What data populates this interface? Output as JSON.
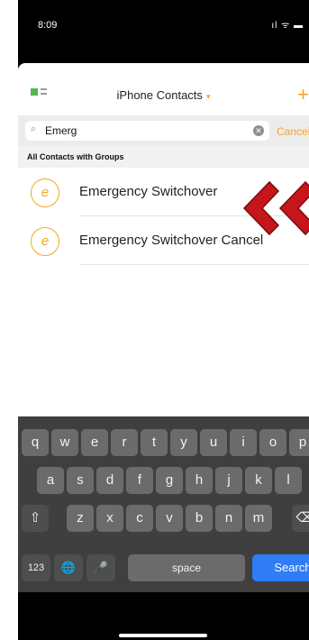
{
  "status_bar": {
    "time": "8:09",
    "icons": "ıl ᯤ ▬"
  },
  "nav": {
    "title": "iPhone Contacts",
    "title_caret": "▾",
    "add_label": "+"
  },
  "search": {
    "value": "Emerg",
    "icon": "⌕",
    "clear": "✕",
    "cancel_label": "Cancel"
  },
  "section": {
    "title": "All Contacts with Groups"
  },
  "contacts": [
    {
      "initial": "e",
      "name": "Emergency Switchover"
    },
    {
      "initial": "e",
      "name": "Emergency Switchover Cancel"
    }
  ],
  "keyboard": {
    "row1": [
      "q",
      "w",
      "e",
      "r",
      "t",
      "y",
      "u",
      "i",
      "o",
      "p"
    ],
    "row2": [
      "a",
      "s",
      "d",
      "f",
      "g",
      "h",
      "j",
      "k",
      "l"
    ],
    "row3": [
      "z",
      "x",
      "c",
      "v",
      "b",
      "n",
      "m"
    ],
    "shift": "⇧",
    "backspace": "⌫",
    "numbers": "123",
    "globe": "🌐",
    "mic": "🎤",
    "space": "space",
    "search": "Search"
  },
  "colors": {
    "accent": "#f5a623",
    "arrow": "#c6161b",
    "search_key": "#2f7cf6"
  }
}
